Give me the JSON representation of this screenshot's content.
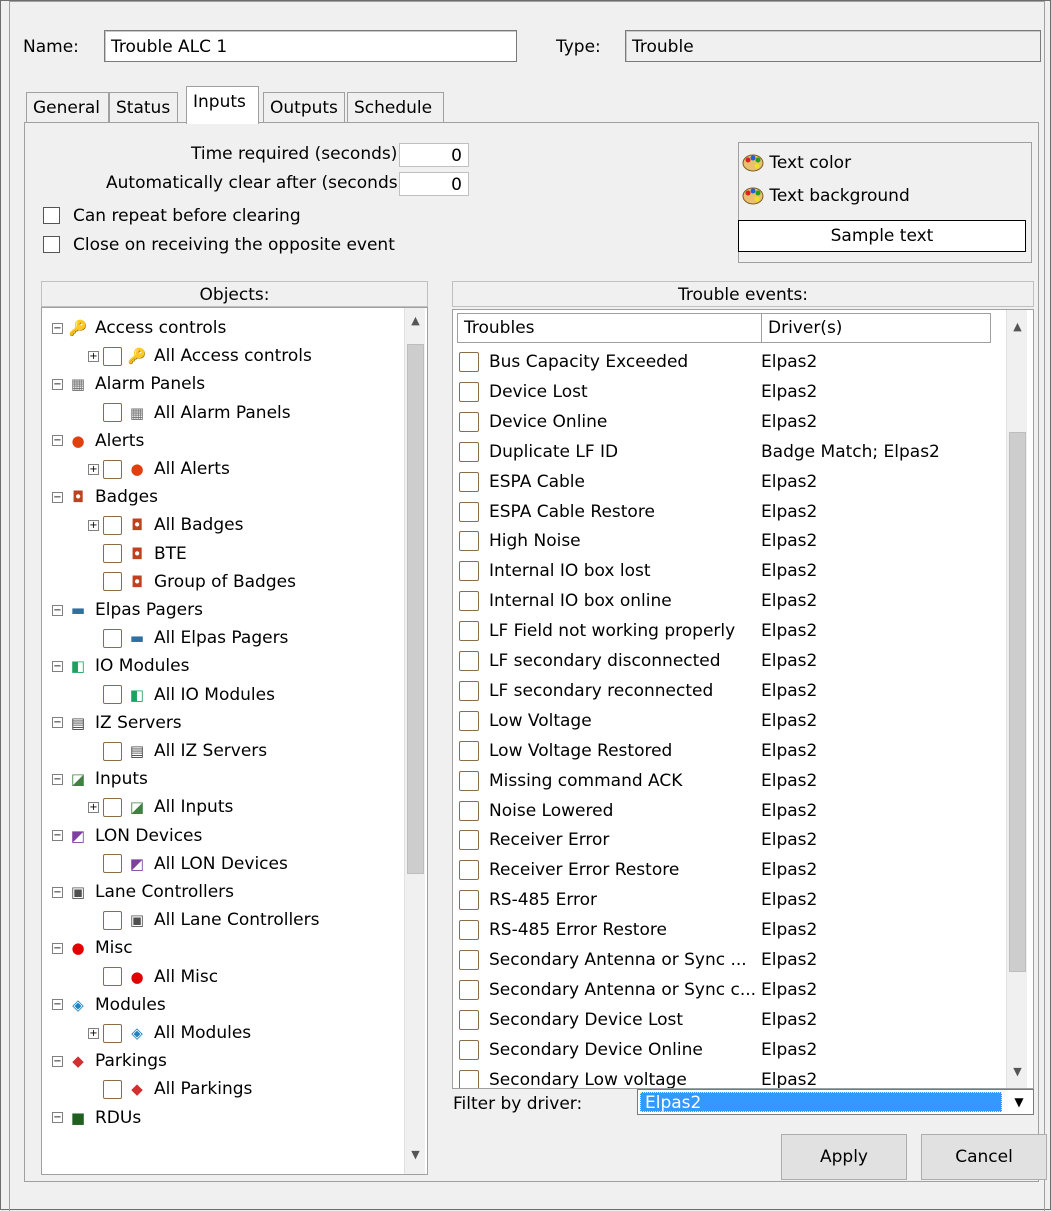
{
  "header": {
    "name_label": "Name:",
    "name_value": "Trouble ALC 1",
    "type_label": "Type:",
    "type_value": "Trouble"
  },
  "tabs": [
    {
      "label": "General"
    },
    {
      "label": "Status"
    },
    {
      "label": "Inputs",
      "active": true
    },
    {
      "label": "Outputs"
    },
    {
      "label": "Schedule"
    }
  ],
  "inputs": {
    "time_required_label": "Time required (seconds):",
    "time_required_value": "0",
    "auto_clear_label": "Automatically clear after (seconds):",
    "auto_clear_value": "0",
    "can_repeat_label": "Can repeat before clearing",
    "close_opposite_label": "Close on receiving the opposite event"
  },
  "colors": {
    "text_color_label": "Text color",
    "text_background_label": "Text background",
    "sample_text": "Sample text"
  },
  "objects": {
    "header": "Objects:",
    "items": [
      {
        "label": "Access controls",
        "icon": "key-icon",
        "level": 0,
        "expander": "minus"
      },
      {
        "label": "All Access controls",
        "icon": "key-icon",
        "level": 1,
        "expander": "plus",
        "checkbox": true
      },
      {
        "label": "Alarm Panels",
        "icon": "alarm-panel-icon",
        "level": 0,
        "expander": "minus"
      },
      {
        "label": "All Alarm Panels",
        "icon": "alarm-panel-icon",
        "level": 1,
        "checkbox": true
      },
      {
        "label": "Alerts",
        "icon": "alert-icon",
        "level": 0,
        "expander": "minus"
      },
      {
        "label": "All Alerts",
        "icon": "alert-icon",
        "level": 1,
        "expander": "plus",
        "checkbox": true
      },
      {
        "label": "Badges",
        "icon": "badge-icon",
        "level": 0,
        "expander": "minus"
      },
      {
        "label": "All Badges",
        "icon": "badge-icon",
        "level": 1,
        "expander": "plus",
        "checkbox": true
      },
      {
        "label": "BTE",
        "icon": "badge-icon",
        "level": 1,
        "checkbox": true
      },
      {
        "label": "Group of Badges",
        "icon": "badge-icon",
        "level": 1,
        "checkbox": true
      },
      {
        "label": "Elpas Pagers",
        "icon": "pager-icon",
        "level": 0,
        "expander": "minus"
      },
      {
        "label": "All Elpas Pagers",
        "icon": "pager-icon",
        "level": 1,
        "checkbox": true
      },
      {
        "label": "IO Modules",
        "icon": "io-module-icon",
        "level": 0,
        "expander": "minus"
      },
      {
        "label": "All IO Modules",
        "icon": "io-module-icon",
        "level": 1,
        "checkbox": true
      },
      {
        "label": "IZ Servers",
        "icon": "server-icon",
        "level": 0,
        "expander": "minus"
      },
      {
        "label": "All IZ Servers",
        "icon": "server-icon",
        "level": 1,
        "checkbox": true
      },
      {
        "label": "Inputs",
        "icon": "input-icon",
        "level": 0,
        "expander": "minus"
      },
      {
        "label": "All Inputs",
        "icon": "input-icon",
        "level": 1,
        "expander": "plus",
        "checkbox": true
      },
      {
        "label": "LON Devices",
        "icon": "lon-device-icon",
        "level": 0,
        "expander": "minus"
      },
      {
        "label": "All LON Devices",
        "icon": "lon-device-icon",
        "level": 1,
        "checkbox": true
      },
      {
        "label": "Lane Controllers",
        "icon": "lane-controller-icon",
        "level": 0,
        "expander": "minus"
      },
      {
        "label": "All Lane Controllers",
        "icon": "lane-controller-icon",
        "level": 1,
        "checkbox": true
      },
      {
        "label": "Misc",
        "icon": "misc-red-dot-icon",
        "level": 0,
        "expander": "minus"
      },
      {
        "label": "All Misc",
        "icon": "misc-red-dot-icon",
        "level": 1,
        "checkbox": true
      },
      {
        "label": "Modules",
        "icon": "modules-icon",
        "level": 0,
        "expander": "minus"
      },
      {
        "label": "All Modules",
        "icon": "modules-icon",
        "level": 1,
        "expander": "plus",
        "checkbox": true
      },
      {
        "label": "Parkings",
        "icon": "car-icon",
        "level": 0,
        "expander": "minus"
      },
      {
        "label": "All Parkings",
        "icon": "car-icon",
        "level": 1,
        "checkbox": true
      },
      {
        "label": "RDUs",
        "icon": "rdu-icon",
        "level": 0,
        "expander": "minus"
      }
    ]
  },
  "trouble_events": {
    "header": "Trouble events:",
    "col_troubles": "Troubles",
    "col_drivers": "Driver(s)",
    "rows": [
      {
        "trouble": "Bus Capacity Exceeded",
        "driver": "Elpas2"
      },
      {
        "trouble": "Device Lost",
        "driver": "Elpas2"
      },
      {
        "trouble": "Device Online",
        "driver": "Elpas2"
      },
      {
        "trouble": "Duplicate LF ID",
        "driver": "Badge Match; Elpas2"
      },
      {
        "trouble": "ESPA Cable",
        "driver": "Elpas2"
      },
      {
        "trouble": "ESPA Cable Restore",
        "driver": "Elpas2"
      },
      {
        "trouble": "High Noise",
        "driver": "Elpas2"
      },
      {
        "trouble": "Internal IO box lost",
        "driver": "Elpas2"
      },
      {
        "trouble": "Internal IO box online",
        "driver": "Elpas2"
      },
      {
        "trouble": "LF Field not working properly",
        "driver": "Elpas2"
      },
      {
        "trouble": "LF secondary disconnected",
        "driver": "Elpas2"
      },
      {
        "trouble": "LF secondary reconnected",
        "driver": "Elpas2"
      },
      {
        "trouble": "Low Voltage",
        "driver": "Elpas2"
      },
      {
        "trouble": "Low Voltage Restored",
        "driver": "Elpas2"
      },
      {
        "trouble": "Missing command ACK",
        "driver": "Elpas2"
      },
      {
        "trouble": "Noise Lowered",
        "driver": "Elpas2"
      },
      {
        "trouble": "Receiver Error",
        "driver": "Elpas2"
      },
      {
        "trouble": "Receiver Error Restore",
        "driver": "Elpas2"
      },
      {
        "trouble": "RS-485 Error",
        "driver": "Elpas2"
      },
      {
        "trouble": "RS-485 Error Restore",
        "driver": "Elpas2"
      },
      {
        "trouble": "Secondary  Antenna or Sync ...",
        "driver": "Elpas2"
      },
      {
        "trouble": "Secondary Antenna or Sync c...",
        "driver": "Elpas2"
      },
      {
        "trouble": "Secondary Device Lost",
        "driver": "Elpas2"
      },
      {
        "trouble": "Secondary Device Online",
        "driver": "Elpas2"
      },
      {
        "trouble": "Secondary Low voltage",
        "driver": "Elpas2"
      }
    ]
  },
  "filter": {
    "label": "Filter by driver:",
    "selected": "Elpas2"
  },
  "buttons": {
    "apply": "Apply",
    "cancel": "Cancel"
  },
  "colors_palette": {
    "selection": "#3399ff",
    "checkbox_border": "#8a6e4a"
  }
}
